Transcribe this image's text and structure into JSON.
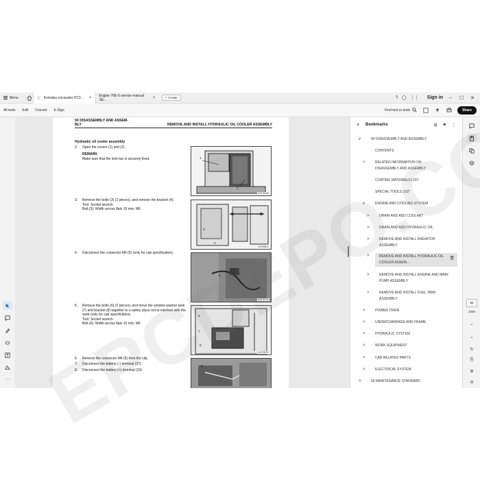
{
  "tabbar": {
    "menu_label": "Menu",
    "tabs": [
      {
        "label": "Komatsu excavator PC2..."
      },
      {
        "label": "Engine 76E-6 service manual SE..."
      }
    ],
    "create_label": "Create",
    "sign_in": "Sign in"
  },
  "toolbar": {
    "items": [
      "All tools",
      "Edit",
      "Convert",
      "E-Sign"
    ],
    "find_label": "Find text or tools",
    "share_label": "Share"
  },
  "document": {
    "header_left": "50 DISASSEMBLY AND ASSEM-\nBLY",
    "header_right": "REMOVE AND INSTALL HYDRAULIC OIL COOLER ASSEMBLY",
    "section_title": "Hydraulic oil cooler assembly",
    "steps": [
      {
        "n": "2.",
        "text": "Open the covers (1) and (2)."
      },
      {
        "n": "3.",
        "text": "Remove the bolts (3) (2 pieces), and remove the bracket (4).\nTool: Socket wrench\nBolt (3): Width across flats 10 mm, M6"
      },
      {
        "n": "4.",
        "text": "Disconnect the connector M6 (5) (only for cab specification)."
      },
      {
        "n": "5.",
        "text": "Remove the bolts (6) (2 pieces), and move the window washer tank (7) and bracket (8) together to a safety place not to interfere with the work (only for cab specification).\nTool: Socket wrench\nBolt (6): Width across flats 10 mm, M6"
      },
      {
        "n": "6.",
        "text": "Remove the connector M4 (9) from the clip."
      },
      {
        "n": "7.",
        "text": "Disconnect the battery (-) terminal (37)."
      },
      {
        "n": "8.",
        "text": "Disconnect the battery (+) terminal (10)."
      }
    ],
    "remark_heading": "REMARK",
    "remark_text": "Make sure that the lock bar is securely fixed.",
    "figure_codes": [
      "9JG78138",
      "9JG98511",
      "9JG78139",
      "9JG78110"
    ],
    "callouts": {
      "fig1": [
        "1",
        "2"
      ],
      "fig2": [
        "3",
        "4"
      ],
      "fig3": [
        "5"
      ],
      "fig4": [
        "6",
        "7",
        "8"
      ],
      "fig5": [
        "9"
      ]
    }
  },
  "bookmarks": {
    "title": "Bookmarks",
    "items": [
      {
        "label": "50 DISASSEMBLY AND ASSEMBLY",
        "chev": "v",
        "level": 0
      },
      {
        "label": "CONTENTS",
        "chev": "",
        "level": 1
      },
      {
        "label": "RELATED INFORMATION ON DISASSEMBLY AND ASSEMBLY",
        "chev": ">",
        "level": 1
      },
      {
        "label": "COATING MATERIALS LIST",
        "chev": "",
        "level": 1
      },
      {
        "label": "SPECIAL TOOLS LIST",
        "chev": "",
        "level": 1
      },
      {
        "label": "ENGINE AND COOLING SYSTEM",
        "chev": "v",
        "level": 1
      },
      {
        "label": "DRAIN AND ADD COOLANT",
        "chev": ">",
        "level": 2
      },
      {
        "label": "DRAIN AND ADD HYDRAULIC OIL",
        "chev": ">",
        "level": 2
      },
      {
        "label": "REMOVE AND INSTALL RADIATOR ASSEMBLY",
        "chev": ">",
        "level": 2
      },
      {
        "label": "REMOVE AND INSTALL HYDRAULIC OIL COOLER ASSEM...",
        "chev": ">",
        "level": 2,
        "selected": true
      },
      {
        "label": "REMOVE AND INSTALL ENGINE AND MAIN PUMP ASSEMBLY",
        "chev": ">",
        "level": 2
      },
      {
        "label": "REMOVE AND INSTALL FUEL TANK ASSEMBLY",
        "chev": ">",
        "level": 2
      },
      {
        "label": "POWER TRAIN",
        "chev": ">",
        "level": 1
      },
      {
        "label": "UNDERCARRIAGE AND FRAME",
        "chev": ">",
        "level": 1
      },
      {
        "label": "HYDRAULIC SYSTEM",
        "chev": ">",
        "level": 1
      },
      {
        "label": "WORK EQUIPMENT",
        "chev": ">",
        "level": 1
      },
      {
        "label": "CAB RELATED PARTS",
        "chev": ">",
        "level": 1
      },
      {
        "label": "ELECTRICAL SYSTEM",
        "chev": ">",
        "level": 1
      },
      {
        "label": "60 MAINTENANCE STANDARD",
        "chev": ">",
        "level": 0
      }
    ]
  },
  "rightrail": {
    "page_current": "50",
    "page_total": "1060"
  },
  "watermark": "EPCDEPO.COM"
}
